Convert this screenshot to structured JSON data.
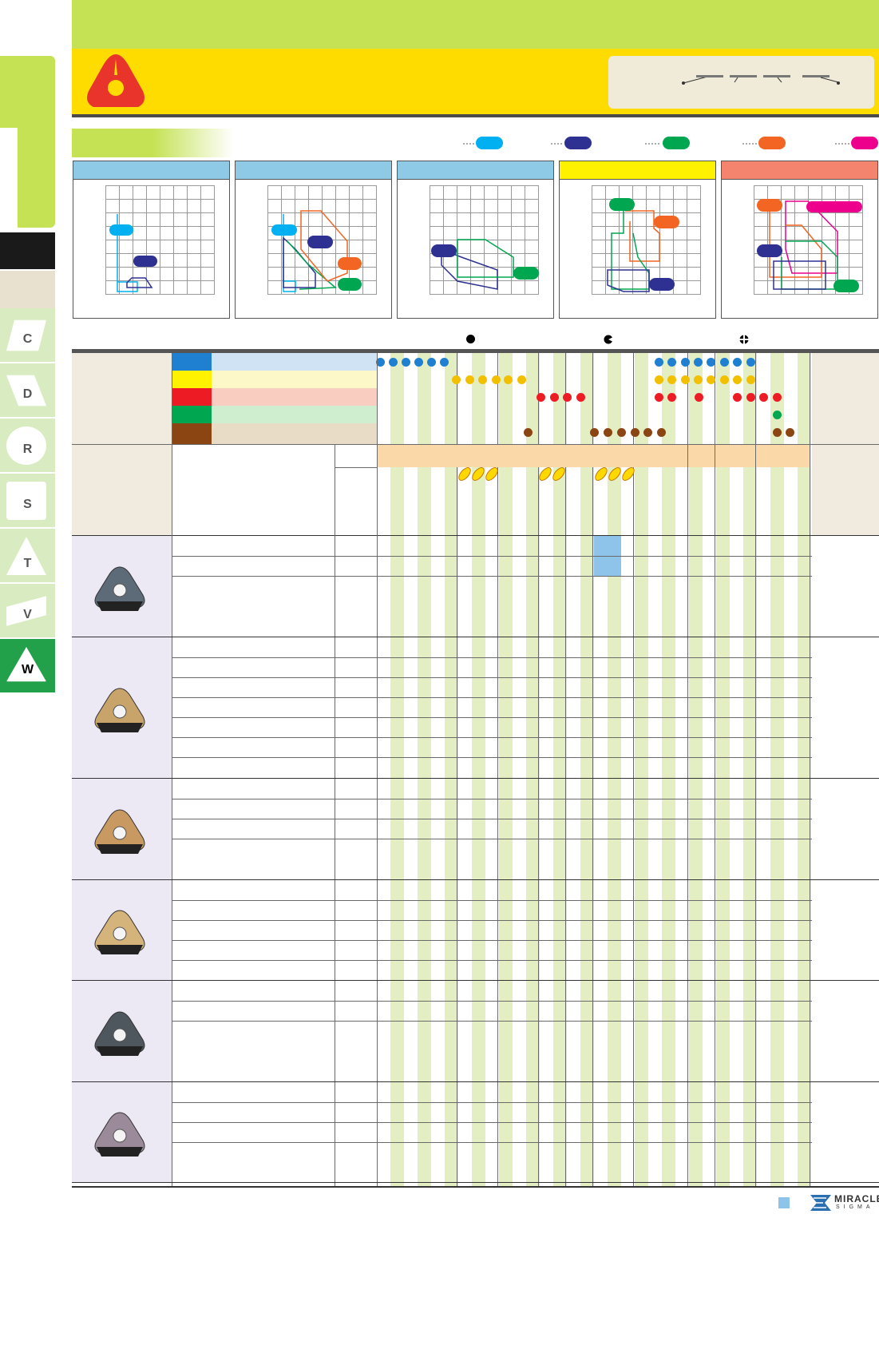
{
  "side_tabs": [
    {
      "key": "c",
      "label": "C"
    },
    {
      "key": "d",
      "label": "D"
    },
    {
      "key": "r",
      "label": "R"
    },
    {
      "key": "s",
      "label": "S"
    },
    {
      "key": "t",
      "label": "T"
    },
    {
      "key": "v",
      "label": "V"
    },
    {
      "key": "w",
      "label": "W"
    }
  ],
  "colors": {
    "green_light": "#c4e254",
    "yellow": "#ffdc00",
    "cyan": "#00b0f0",
    "navy": "#2e3192",
    "green": "#00a650",
    "orange": "#f26522",
    "magenta": "#ec008c",
    "accent_red": "#e8342a"
  },
  "legend_pills": [
    "cyan",
    "navy",
    "green",
    "orange",
    "magenta"
  ],
  "diagram_panels": [
    {
      "head_color": "#8ecae6"
    },
    {
      "head_color": "#8ecae6"
    },
    {
      "head_color": "#8ecae6"
    },
    {
      "head_color": "#fff200"
    },
    {
      "head_color": "#f4846e"
    }
  ],
  "material_rows": [
    {
      "color": "#1f7fd0",
      "bg": "#cfe3f5"
    },
    {
      "color": "#fff200",
      "bg": "#fdf8c8"
    },
    {
      "color": "#ed1c24",
      "bg": "#f9cdc0"
    },
    {
      "color": "#00a650",
      "bg": "#cfeecf"
    },
    {
      "color": "#8b4513",
      "bg": "#e8dcc6"
    }
  ],
  "insert_groups": [
    {
      "rows": 3,
      "color": "#5d6a78"
    },
    {
      "rows": 7,
      "color": "#c9a46a"
    },
    {
      "rows": 4,
      "color": "#c89a62"
    },
    {
      "rows": 5,
      "color": "#d4b47a"
    },
    {
      "rows": 3,
      "color": "#4e565e"
    },
    {
      "rows": 4,
      "color": "#9a8a9a"
    }
  ],
  "brand": {
    "name": "MIRACLE",
    "sub": "SIGMA"
  }
}
